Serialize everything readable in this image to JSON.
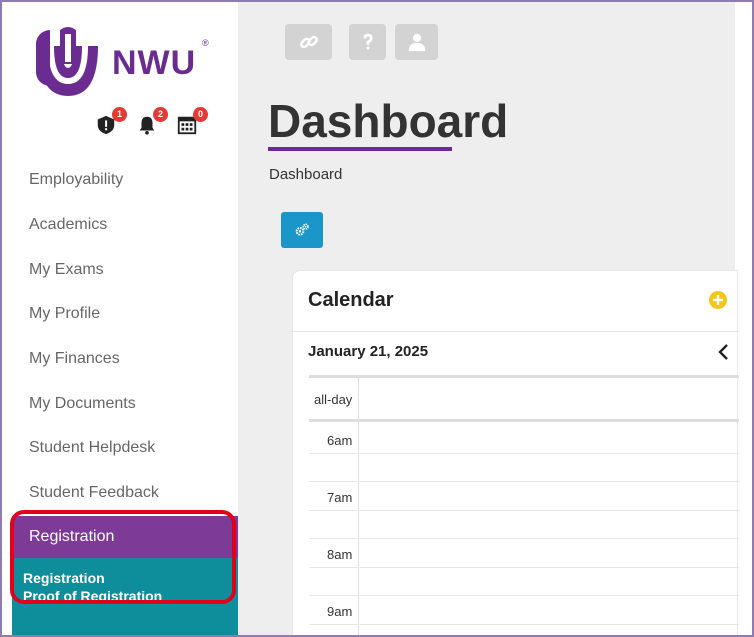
{
  "brand": {
    "name": "NWU",
    "registered": "®",
    "colors": {
      "primary": "#6b2c91",
      "teal": "#0e8e9a",
      "blue_button": "#1b96c8",
      "badge": "#e53935",
      "highlight": "#e0001a"
    }
  },
  "notifications": [
    {
      "icon": "alert-shield-icon",
      "count": "1"
    },
    {
      "icon": "bell-icon",
      "count": "2"
    },
    {
      "icon": "calendar-grid-icon",
      "count": "0"
    }
  ],
  "sidebar": {
    "items": [
      {
        "label": "Employability"
      },
      {
        "label": "Academics"
      },
      {
        "label": "My Exams"
      },
      {
        "label": "My Profile"
      },
      {
        "label": "My Finances"
      },
      {
        "label": "My Documents"
      },
      {
        "label": "Student Helpdesk"
      },
      {
        "label": "Student Feedback"
      }
    ],
    "registration": {
      "header": "Registration",
      "sub_items": [
        "Registration",
        "Proof of Registration"
      ]
    }
  },
  "topbar": {
    "buttons": [
      "link-icon",
      "question-icon",
      "user-icon"
    ]
  },
  "page": {
    "title": "Dashboard",
    "breadcrumb": "Dashboard",
    "settings_button_icon": "gears-icon"
  },
  "calendar": {
    "title": "Calendar",
    "date": "January 21, 2025",
    "allday_label": "all-day",
    "times": [
      "6am",
      "7am",
      "8am",
      "9am"
    ]
  }
}
